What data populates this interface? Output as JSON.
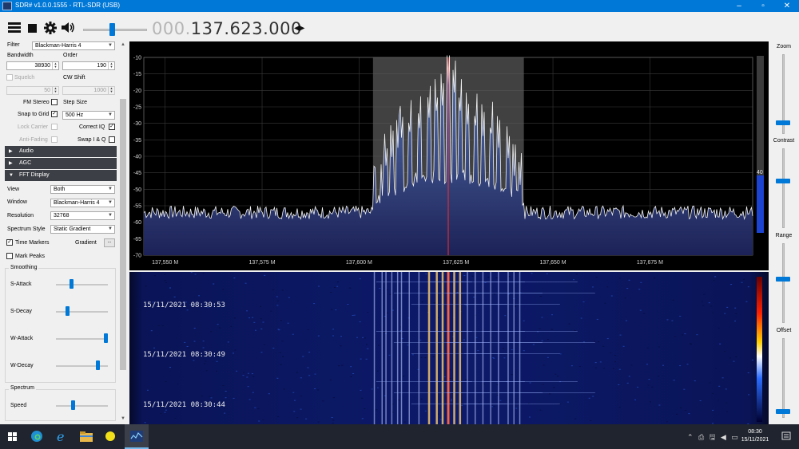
{
  "window": {
    "title": "SDR# v1.0.0.1555 - RTL-SDR (USB)",
    "minimize_glyph": "–",
    "maximize_glyph": "▫",
    "close_glyph": "✕"
  },
  "toolbar": {
    "menu_icon": "hamburger-icon",
    "stop_icon": "stop-icon",
    "settings_icon": "gear-icon",
    "audio_icon": "speaker-icon",
    "volume_level": 0.45,
    "frequency_prefix": "000.",
    "frequency_main": "137.623.000",
    "tuning_arrows": "◀▶"
  },
  "radio": {
    "filter_label": "Filter",
    "filter_value": "Blackman-Harris 4",
    "bandwidth_label": "Bandwidth",
    "bandwidth_value": "38930",
    "order_label": "Order",
    "order_value": "190",
    "squelch_label": "Squelch",
    "squelch_value": "50",
    "cwshift_label": "CW Shift",
    "cwshift_value": "1000",
    "fmstereo_label": "FM Stereo",
    "stepsize_label": "Step Size",
    "snaptogrid_label": "Snap to Grid",
    "stepsize_value": "500 Hz",
    "lockcarrier_label": "Lock Carrier",
    "correctiq_label": "Correct IQ",
    "antifading_label": "Anti-Fading",
    "swapiq_label": "Swap I & Q",
    "check_glyph": "✓"
  },
  "sections": {
    "audio": "Audio",
    "agc": "AGC",
    "fft": "FFT Display",
    "collapsed_glyph": "▶",
    "expanded_glyph": "▼"
  },
  "fft": {
    "view_label": "View",
    "view_value": "Both",
    "window_label": "Window",
    "window_value": "Blackman-Harris 4",
    "resolution_label": "Resolution",
    "resolution_value": "32768",
    "style_label": "Spectrum Style",
    "style_value": "Static Gradient",
    "timemarkers_label": "Time Markers",
    "gradient_label": "Gradient",
    "gradient_button": "...",
    "markpeaks_label": "Mark Peaks",
    "smoothing_title": "Smoothing",
    "sattack_label": "S-Attack",
    "sdecay_label": "S-Decay",
    "wattack_label": "W-Attack",
    "wdecay_label": "W-Decay",
    "spectrum_title": "Spectrum",
    "speed_label": "Speed",
    "levels": {
      "sattack": 0.28,
      "sdecay": 0.2,
      "wattack": 0.97,
      "wdecay": 0.8,
      "speed": 0.3
    }
  },
  "chart_data": {
    "type": "line",
    "title": "",
    "xlabel": "",
    "ylabel": "",
    "x_ticks": [
      "137,550 M",
      "137,575 M",
      "137,600 M",
      "137,625 M",
      "137,650 M",
      "137,675 M"
    ],
    "x_tick_values": [
      137.55,
      137.575,
      137.6,
      137.625,
      137.65,
      137.675
    ],
    "y_ticks": [
      "-10",
      "-15",
      "-20",
      "-25",
      "-30",
      "-35",
      "-40",
      "-45",
      "-50",
      "-55",
      "-60",
      "-65",
      "-70"
    ],
    "xlim": [
      137.5445,
      137.7015
    ],
    "ylim": [
      -70,
      -10
    ],
    "noise_floor_db": -57,
    "filter_band": [
      137.6036,
      137.6425
    ],
    "center_frequency": 137.623,
    "peak_level_label": "40",
    "series": [
      {
        "x": [
          137.604,
          137.606,
          137.607,
          137.6085,
          137.61,
          137.611,
          137.613,
          137.6155,
          137.618,
          137.62,
          137.6215,
          137.623,
          137.6245,
          137.626,
          137.628,
          137.63,
          137.632,
          137.634,
          137.636,
          137.6385,
          137.64,
          137.6415
        ],
        "y": [
          -48,
          -52,
          -45,
          -41,
          -38,
          -36,
          -36,
          -34,
          -30,
          -29,
          -26,
          -19,
          -22,
          -29,
          -32,
          -34,
          -35,
          -37,
          -38,
          -42,
          -46,
          -50
        ]
      }
    ]
  },
  "waterfall": {
    "timestamps": [
      "15/11/2021 08:30:53",
      "15/11/2021 08:30:49",
      "15/11/2021 08:30:44"
    ]
  },
  "rightpanel": {
    "zoom_label": "Zoom",
    "contrast_label": "Contrast",
    "range_label": "Range",
    "offset_label": "Offset",
    "levels": {
      "zoom": 0.12,
      "contrast": 0.6,
      "range": 0.55,
      "offset": 0.05
    }
  },
  "taskbar": {
    "start_icon": "windows-start-icon",
    "apps": [
      "edge-icon",
      "internet-explorer-icon",
      "file-explorer-icon",
      "sdr-yellow-icon",
      "sdrsharp-icon"
    ],
    "tray_glyphs": "⌃ ⎙ 🖫 ◀ ▭",
    "clock_time": "08:30",
    "clock_date": "15/11/2021"
  }
}
